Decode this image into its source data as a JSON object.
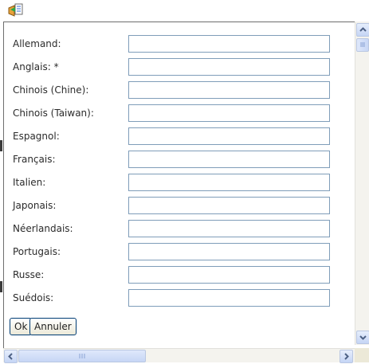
{
  "toolbar": {
    "icon": "translate-form-icon"
  },
  "form": {
    "fields": [
      {
        "label": "Allemand:",
        "value": ""
      },
      {
        "label": "Anglais: *",
        "value": ""
      },
      {
        "label": "Chinois (Chine):",
        "value": ""
      },
      {
        "label": "Chinois (Taiwan):",
        "value": ""
      },
      {
        "label": "Espagnol:",
        "value": ""
      },
      {
        "label": "Français:",
        "value": ""
      },
      {
        "label": "Italien:",
        "value": ""
      },
      {
        "label": "Japonais:",
        "value": ""
      },
      {
        "label": "Néerlandais:",
        "value": ""
      },
      {
        "label": "Portugais:",
        "value": ""
      },
      {
        "label": "Russe:",
        "value": ""
      },
      {
        "label": "Suédois:",
        "value": ""
      }
    ],
    "ok_label": "Ok",
    "cancel_label": "Annuler"
  },
  "colors": {
    "input_border": "#7f9db9",
    "button_border": "#003c74",
    "scrollbar_blue": "#c5d5f5"
  }
}
